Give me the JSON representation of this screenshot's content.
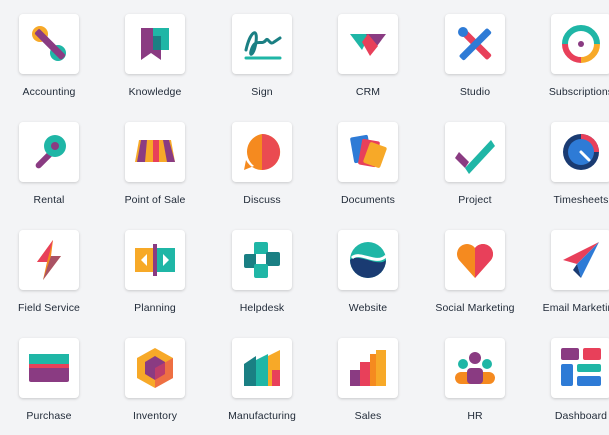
{
  "apps": [
    {
      "label": "Accounting",
      "icon": "accounting-icon"
    },
    {
      "label": "Knowledge",
      "icon": "knowledge-icon"
    },
    {
      "label": "Sign",
      "icon": "sign-icon"
    },
    {
      "label": "CRM",
      "icon": "crm-icon"
    },
    {
      "label": "Studio",
      "icon": "studio-icon"
    },
    {
      "label": "Subscriptions",
      "icon": "subscriptions-icon"
    },
    {
      "label": "Rental",
      "icon": "rental-icon"
    },
    {
      "label": "Point of Sale",
      "icon": "point-of-sale-icon"
    },
    {
      "label": "Discuss",
      "icon": "discuss-icon"
    },
    {
      "label": "Documents",
      "icon": "documents-icon"
    },
    {
      "label": "Project",
      "icon": "project-icon"
    },
    {
      "label": "Timesheets",
      "icon": "timesheets-icon"
    },
    {
      "label": "Field Service",
      "icon": "field-service-icon"
    },
    {
      "label": "Planning",
      "icon": "planning-icon"
    },
    {
      "label": "Helpdesk",
      "icon": "helpdesk-icon"
    },
    {
      "label": "Website",
      "icon": "website-icon"
    },
    {
      "label": "Social Marketing",
      "icon": "social-marketing-icon"
    },
    {
      "label": "Email Marketing",
      "icon": "email-marketing-icon"
    },
    {
      "label": "Purchase",
      "icon": "purchase-icon"
    },
    {
      "label": "Inventory",
      "icon": "inventory-icon"
    },
    {
      "label": "Manufacturing",
      "icon": "manufacturing-icon"
    },
    {
      "label": "Sales",
      "icon": "sales-icon"
    },
    {
      "label": "HR",
      "icon": "hr-icon"
    },
    {
      "label": "Dashboard",
      "icon": "dashboard-icon"
    }
  ]
}
